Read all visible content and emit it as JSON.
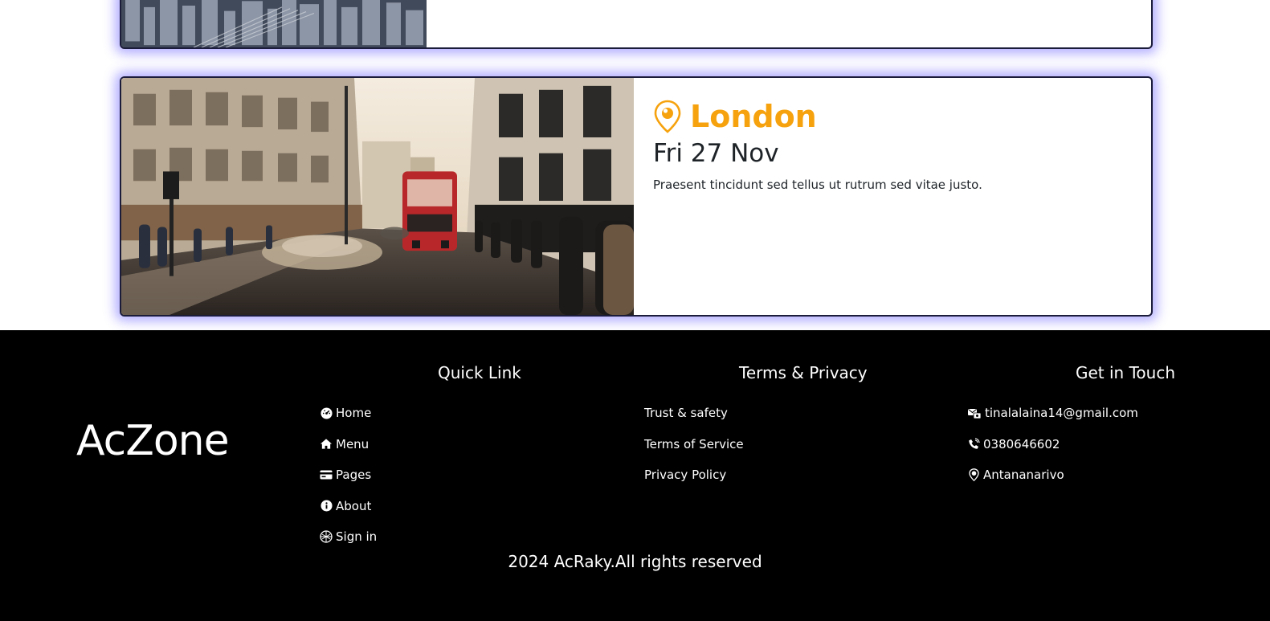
{
  "cards": {
    "main": {
      "city": "London",
      "date": "Fri 27 Nov",
      "description": "Praesent tincidunt sed tellus ut rutrum sed vitae justo."
    }
  },
  "colors": {
    "accent": "#f6a20e",
    "card_glow": "#5a50ff",
    "footer_bg": "#000000"
  },
  "footer": {
    "brand": "AcZone",
    "quick_link": {
      "title": "Quick Link",
      "items": [
        {
          "label": "Home",
          "icon": "dashboard-icon"
        },
        {
          "label": "Menu",
          "icon": "home-icon"
        },
        {
          "label": "Pages",
          "icon": "card-icon"
        },
        {
          "label": "About",
          "icon": "info-icon"
        },
        {
          "label": "Sign in",
          "icon": "grid-globe-icon"
        }
      ]
    },
    "terms": {
      "title": "Terms & Privacy",
      "items": [
        {
          "label": "Trust & safety"
        },
        {
          "label": "Terms of Service"
        },
        {
          "label": "Privacy Policy"
        }
      ]
    },
    "contact": {
      "title": "Get in Touch",
      "items": [
        {
          "label": "tinalalaina14@gmail.com",
          "icon": "mail-icon"
        },
        {
          "label": "0380646602",
          "icon": "phone-icon"
        },
        {
          "label": "Antananarivo",
          "icon": "location-icon"
        }
      ]
    },
    "copyright": "2024 AcRaky.All rights reserved"
  }
}
